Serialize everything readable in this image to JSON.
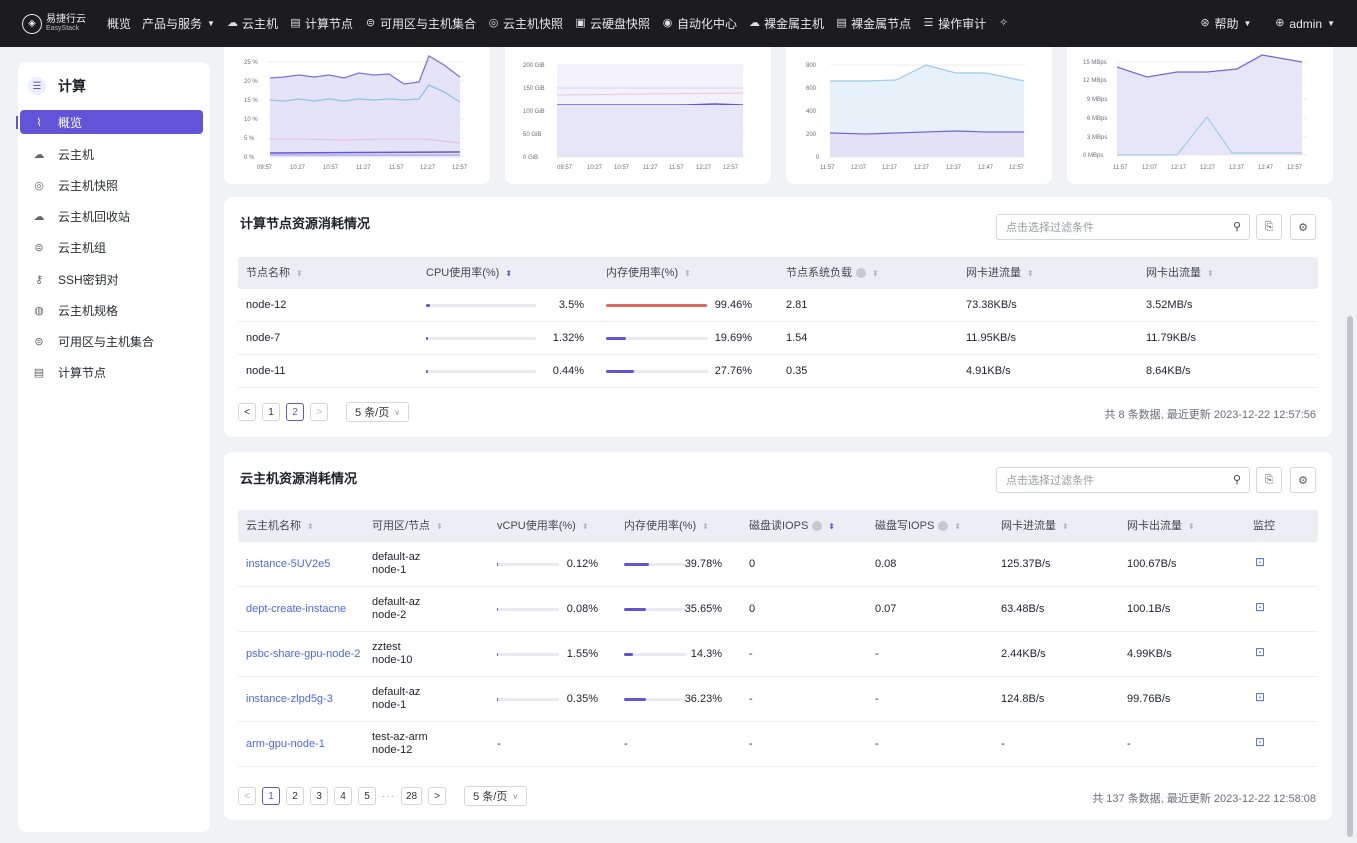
{
  "header": {
    "logo_cn": "易捷行云",
    "logo_en": "EasyStack",
    "nav": [
      {
        "label": "概览",
        "icon": ""
      },
      {
        "label": "产品与服务",
        "icon": "",
        "caret": true
      },
      {
        "label": "云主机",
        "icon": "cloud-icon"
      },
      {
        "label": "计算节点",
        "icon": "server-icon"
      },
      {
        "label": "可用区与主机集合",
        "icon": "cluster-icon"
      },
      {
        "label": "云主机快照",
        "icon": "snapshot-icon"
      },
      {
        "label": "云硬盘快照",
        "icon": "disk-snapshot-icon"
      },
      {
        "label": "自动化中心",
        "icon": "automation-icon"
      },
      {
        "label": "裸金属主机",
        "icon": "cloud-icon"
      },
      {
        "label": "裸金属节点",
        "icon": "server-icon"
      },
      {
        "label": "操作审计",
        "icon": "audit-icon"
      }
    ],
    "help": "帮助",
    "user": "admin"
  },
  "sidebar": {
    "title": "计算",
    "items": [
      {
        "label": "概览",
        "icon": "chart-icon",
        "active": true
      },
      {
        "label": "云主机",
        "icon": "cloud-icon"
      },
      {
        "label": "云主机快照",
        "icon": "snapshot-icon"
      },
      {
        "label": "云主机回收站",
        "icon": "recycle-icon"
      },
      {
        "label": "云主机组",
        "icon": "group-icon"
      },
      {
        "label": "SSH密钥对",
        "icon": "key-icon"
      },
      {
        "label": "云主机规格",
        "icon": "spec-icon"
      },
      {
        "label": "可用区与主机集合",
        "icon": "cluster-icon"
      },
      {
        "label": "计算节点",
        "icon": "server-icon"
      }
    ]
  },
  "charts": [
    {
      "type": "line",
      "y_ticks": [
        "25 %",
        "20 %",
        "15 %",
        "10 %",
        "5 %",
        "0 %"
      ],
      "x_ticks": [
        "09:57",
        "10:27",
        "10:57",
        "11:27",
        "11:57",
        "12:27",
        "12:57"
      ]
    },
    {
      "type": "line",
      "y_ticks": [
        "200 GiB",
        "150 GiB",
        "100 GiB",
        "50 GiB",
        "0 GiB"
      ],
      "x_ticks": [
        "09:57",
        "10:27",
        "10:57",
        "11:27",
        "11:57",
        "12:27",
        "12:57"
      ]
    },
    {
      "type": "line",
      "y_ticks": [
        "800",
        "600",
        "400",
        "200",
        "0"
      ],
      "x_ticks": [
        "11:57",
        "12:07",
        "12:17",
        "12:27",
        "12:37",
        "12:47",
        "12:57"
      ]
    },
    {
      "type": "line",
      "y_ticks": [
        "15 MBps",
        "12 MBps",
        "9 MBps",
        "6 MBps",
        "3 MBps",
        "0 MBps"
      ],
      "x_ticks": [
        "11:57",
        "12:07",
        "12:17",
        "12:27",
        "12:37",
        "12:47",
        "12:57"
      ]
    }
  ],
  "nodes": {
    "title": "计算节点资源消耗情况",
    "filter_placeholder": "点击选择过滤条件",
    "columns": [
      "节点名称",
      "CPU使用率(%)",
      "内存使用率(%)",
      "节点系统负载",
      "网卡进流量",
      "网卡出流量"
    ],
    "rows": [
      {
        "name": "node-12",
        "cpu": "3.5%",
        "cpu_v": 0.035,
        "mem": "99.46%",
        "mem_v": 0.9946,
        "load": "2.81",
        "in": "73.38KB/s",
        "out": "3.52MB/s"
      },
      {
        "name": "node-7",
        "cpu": "1.32%",
        "cpu_v": 0.0132,
        "mem": "19.69%",
        "mem_v": 0.1969,
        "load": "1.54",
        "in": "11.95KB/s",
        "out": "11.79KB/s"
      },
      {
        "name": "node-11",
        "cpu": "0.44%",
        "cpu_v": 0.0044,
        "mem": "27.76%",
        "mem_v": 0.2776,
        "load": "0.35",
        "in": "4.91KB/s",
        "out": "8.64KB/s"
      }
    ],
    "pages": [
      "1",
      "2"
    ],
    "current_page": "2",
    "page_size": "5 条/页",
    "summary": "共 8 条数据,  最近更新  2023-12-22 12:57:56"
  },
  "vms": {
    "title": "云主机资源消耗情况",
    "filter_placeholder": "点击选择过滤条件",
    "columns": [
      "云主机名称",
      "可用区/节点",
      "vCPU使用率(%)",
      "内存使用率(%)",
      "磁盘读IOPS",
      "磁盘写IOPS",
      "网卡进流量",
      "网卡出流量",
      "监控"
    ],
    "rows": [
      {
        "name": "instance-5UV2e5",
        "az": "default-az",
        "node": "node-1",
        "cpu": "0.12%",
        "cpu_v": 0.0012,
        "mem": "39.78%",
        "mem_v": 0.3978,
        "rd": "0",
        "wr": "0.08",
        "in": "125.37B/s",
        "out": "100.67B/s"
      },
      {
        "name": "dept-create-instacne",
        "az": "default-az",
        "node": "node-2",
        "cpu": "0.08%",
        "cpu_v": 0.0008,
        "mem": "35.65%",
        "mem_v": 0.3565,
        "rd": "0",
        "wr": "0.07",
        "in": "63.48B/s",
        "out": "100.1B/s"
      },
      {
        "name": "psbc-share-gpu-node-2",
        "az": "zztest",
        "node": "node-10",
        "cpu": "1.55%",
        "cpu_v": 0.0155,
        "mem": "14.3%",
        "mem_v": 0.143,
        "rd": "-",
        "wr": "-",
        "in": "2.44KB/s",
        "out": "4.99KB/s"
      },
      {
        "name": "instance-zlpd5g-3",
        "az": "default-az",
        "node": "node-1",
        "cpu": "0.35%",
        "cpu_v": 0.0035,
        "mem": "36.23%",
        "mem_v": 0.3623,
        "rd": "-",
        "wr": "-",
        "in": "124.8B/s",
        "out": "99.76B/s"
      },
      {
        "name": "arm-gpu-node-1",
        "az": "test-az-arm",
        "node": "node-12",
        "cpu": "-",
        "cpu_v": null,
        "mem": "-",
        "mem_v": null,
        "rd": "-",
        "wr": "-",
        "in": "-",
        "out": "-"
      }
    ],
    "pages": [
      "1",
      "2",
      "3",
      "4",
      "5",
      "28"
    ],
    "current_page": "1",
    "page_size": "5 条/页",
    "summary": "共 137 条数据,  最近更新  2023-12-22 12:58:08"
  }
}
